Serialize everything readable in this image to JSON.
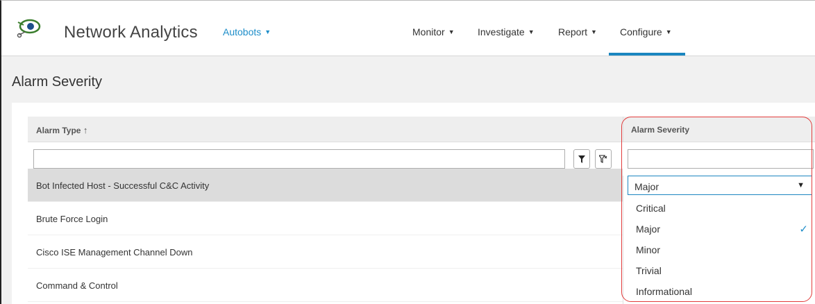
{
  "header": {
    "app_title": "Network Analytics",
    "tenant": "Autobots",
    "nav": [
      {
        "label": "Monitor"
      },
      {
        "label": "Investigate"
      },
      {
        "label": "Report"
      },
      {
        "label": "Configure",
        "active": true
      }
    ]
  },
  "page": {
    "title": "Alarm Severity"
  },
  "grid": {
    "columns": [
      {
        "label": "Alarm Type",
        "sort": "↑"
      },
      {
        "label": "Alarm Severity"
      }
    ],
    "rows": [
      {
        "alarm_type": "Bot Infected Host - Successful C&C Activity",
        "selected": true
      },
      {
        "alarm_type": "Brute Force Login"
      },
      {
        "alarm_type": "Cisco ISE Management Channel Down"
      },
      {
        "alarm_type": "Command & Control"
      }
    ]
  },
  "severity_dropdown": {
    "selected": "Major",
    "options": [
      "Critical",
      "Major",
      "Minor",
      "Trivial",
      "Informational"
    ],
    "checked": "Major"
  },
  "colors": {
    "accent": "#1d8dc9",
    "nav_underline": "#1b86c0",
    "highlight_ring": "#e23b3b",
    "selected_row": "#dcdcdc"
  },
  "icons": {
    "logo": "network-analytics-logo",
    "filter": "filter-icon",
    "clear_filter": "clear-filter-icon",
    "check": "check-icon"
  }
}
